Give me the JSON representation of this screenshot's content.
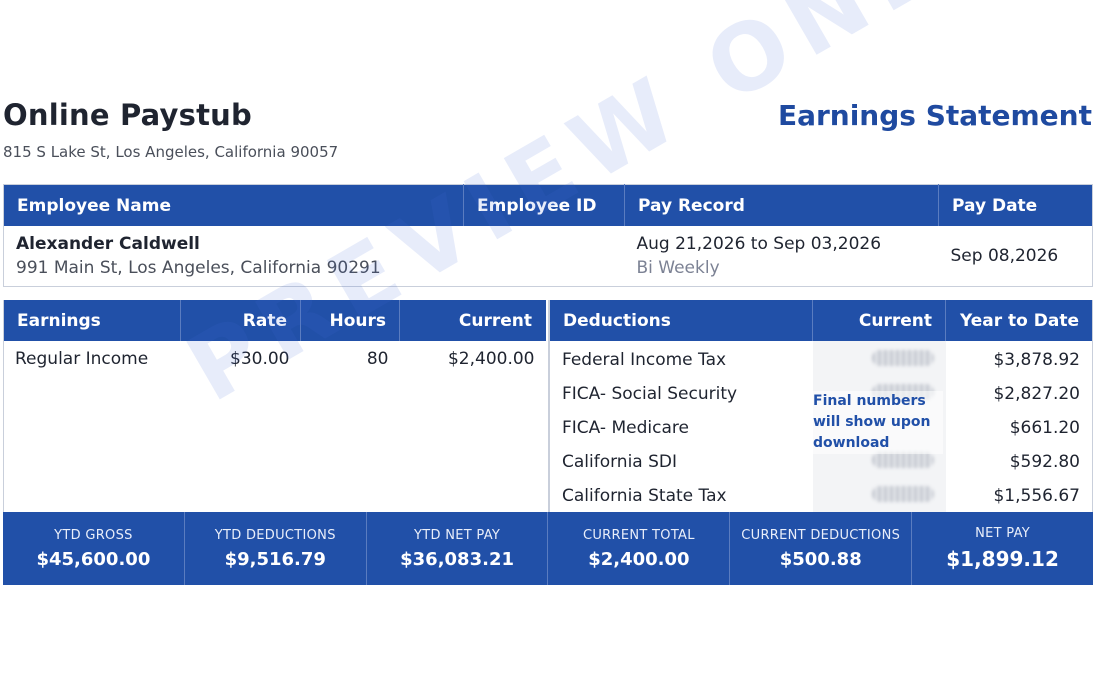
{
  "header": {
    "company_name": "Online Paystub",
    "company_address": "815 S Lake St, Los Angeles, California 90057",
    "statement_title": "Earnings Statement"
  },
  "employee_table": {
    "headers": {
      "employee_name": "Employee Name",
      "employee_id": "Employee ID",
      "pay_record": "Pay Record",
      "pay_date": "Pay Date"
    },
    "employee_name": "Alexander Caldwell",
    "employee_address": "991 Main St, Los Angeles, California 90291",
    "employee_id": "",
    "pay_period": "Aug 21,2026 to Sep 03,2026",
    "pay_frequency": "Bi Weekly",
    "pay_date": "Sep 08,2026"
  },
  "earnings": {
    "headers": {
      "earnings": "Earnings",
      "rate": "Rate",
      "hours": "Hours",
      "current": "Current"
    },
    "rows": [
      {
        "label": "Regular Income",
        "rate": "$30.00",
        "hours": "80",
        "current": "$2,400.00"
      }
    ]
  },
  "deductions": {
    "headers": {
      "deductions": "Deductions",
      "current": "Current",
      "ytd": "Year to Date"
    },
    "rows": [
      {
        "label": "Federal Income Tax",
        "ytd": "$3,878.92"
      },
      {
        "label": "FICA- Social Security",
        "ytd": "$2,827.20"
      },
      {
        "label": "FICA- Medicare",
        "ytd": "$661.20"
      },
      {
        "label": "California SDI",
        "ytd": "$592.80"
      },
      {
        "label": "California State Tax",
        "ytd": "$1,556.67"
      }
    ],
    "notice": "Final numbers will show upon download"
  },
  "totals": {
    "ytd_gross_label": "YTD GROSS",
    "ytd_gross": "$45,600.00",
    "ytd_deductions_label": "YTD DEDUCTIONS",
    "ytd_deductions": "$9,516.79",
    "ytd_net_label": "YTD NET PAY",
    "ytd_net": "$36,083.21",
    "current_total_label": "CURRENT TOTAL",
    "current_total": "$2,400.00",
    "current_deductions_label": "CURRENT DEDUCTIONS",
    "current_deductions": "$500.88",
    "net_pay_label": "NET PAY",
    "net_pay": "$1,899.12"
  },
  "watermark": "PREVIEW ONLY",
  "colors": {
    "accent": "#2150a8",
    "title": "#1f4aa0",
    "text": "#1f2430"
  }
}
